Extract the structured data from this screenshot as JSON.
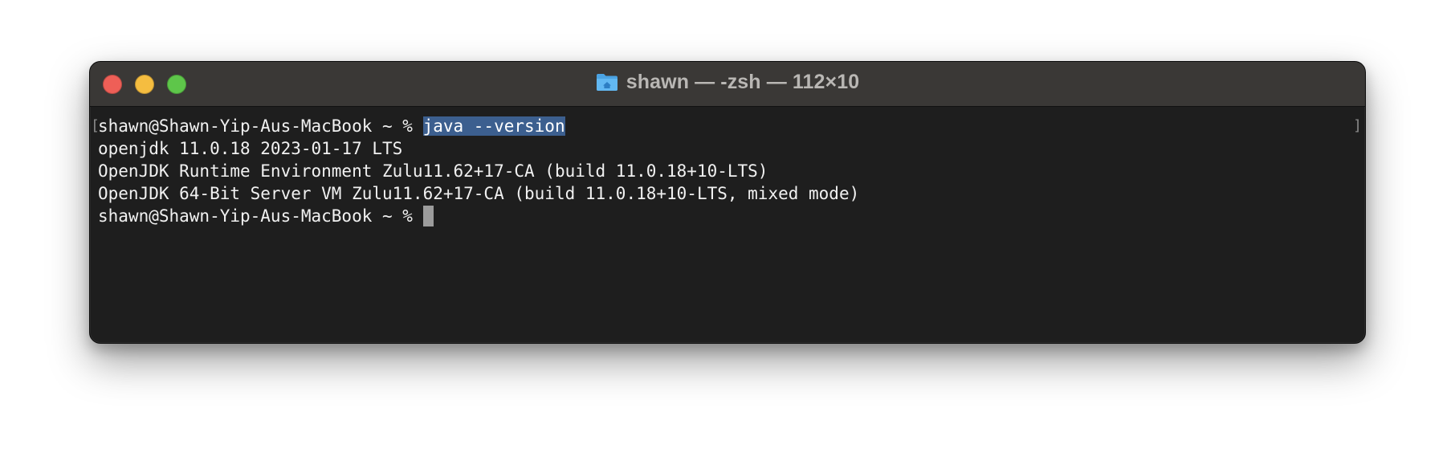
{
  "window": {
    "title": "shawn — -zsh — 112×10",
    "title_icon": "folder-home-icon",
    "buttons": {
      "close": "close-icon",
      "minimize": "minimize-icon",
      "zoom": "zoom-icon"
    }
  },
  "terminal": {
    "prompt": "shawn@Shawn-Yip-Aus-MacBook ~ % ",
    "command": "java --version",
    "output": [
      "openjdk 11.0.18 2023-01-17 LTS",
      "OpenJDK Runtime Environment Zulu11.62+17-CA (build 11.0.18+10-LTS)",
      "OpenJDK 64-Bit Server VM Zulu11.62+17-CA (build 11.0.18+10-LTS, mixed mode)"
    ],
    "current_prompt": "shawn@Shawn-Yip-Aus-MacBook ~ % ",
    "mark_left": "[",
    "mark_right": "]"
  },
  "colors": {
    "background": "#1e1e1e",
    "titlebar": "#3a3836",
    "text": "#f1f1f1",
    "selection": "#3c5f8f",
    "cursor": "#9c9c9c",
    "close": "#ee5f57",
    "minimize": "#f5bd40",
    "zoom": "#5ec64a"
  }
}
